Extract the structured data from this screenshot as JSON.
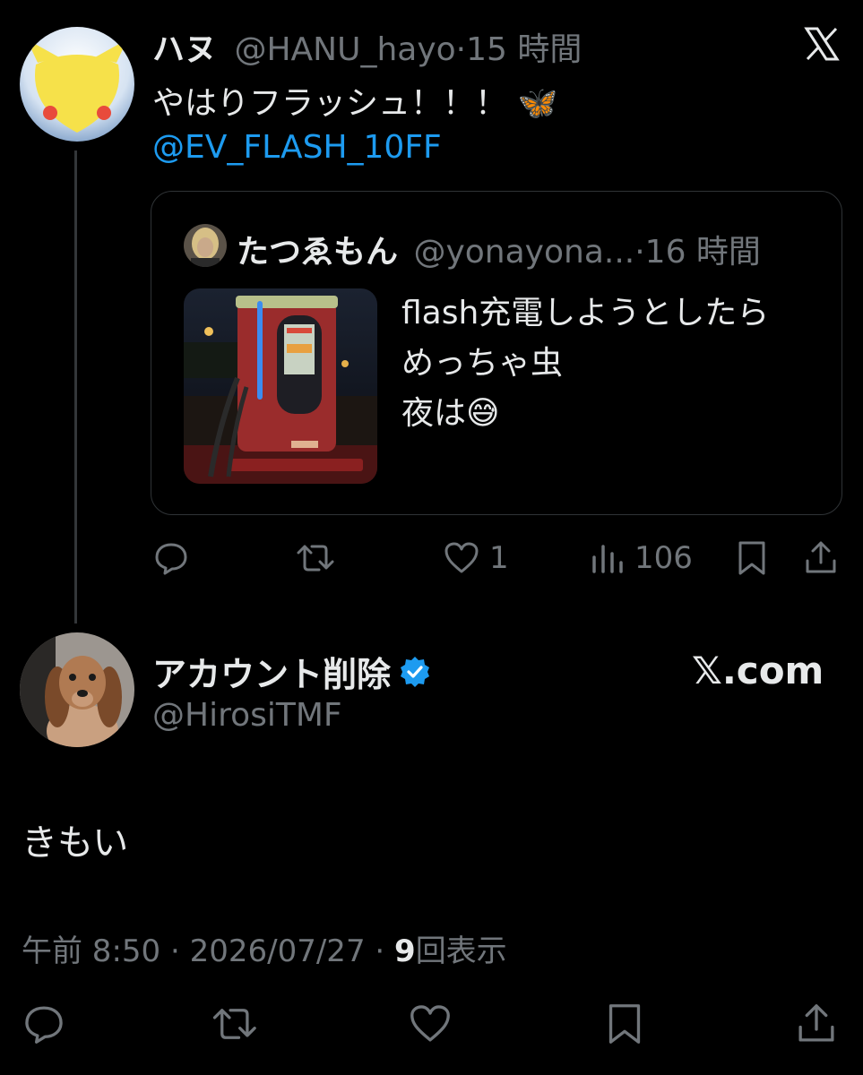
{
  "top_close_icon": "x-logo-icon",
  "reply_tweet": {
    "author_name": "ハヌ",
    "handle": "@HANU_hayo",
    "separator": "·",
    "time": "15 時間",
    "text_line1": "やはりフラッシュ！！！ 🦋",
    "mention": "@EV_FLASH_10FF",
    "quote": {
      "author_name": "たつゑもん",
      "handle": "@yonayona...",
      "separator": "·",
      "time": "16 時間",
      "text_lines": [
        "flash充電しようとしたら",
        "めっちゃ虫",
        "夜は😅"
      ]
    },
    "actions": {
      "reply_icon": "reply-icon",
      "retweet_icon": "retweet-icon",
      "like_icon": "heart-icon",
      "like_count": "1",
      "views_icon": "views-chart-icon",
      "views_count": "106",
      "bookmark_icon": "bookmark-icon",
      "share_icon": "share-icon"
    }
  },
  "main_tweet": {
    "author_name": "アカウント削除",
    "verified_icon": "verified-badge-icon",
    "handle": "@HirosiTMF",
    "brand": "𝕏.com",
    "text": "きもい",
    "meta_time": "午前 8:50",
    "meta_sep1": "·",
    "meta_date": "2026/07/27",
    "meta_sep2": "·",
    "views_count": "9",
    "views_label": "回表示"
  },
  "colors": {
    "background": "#000000",
    "text": "#e7e9ea",
    "muted": "#71767b",
    "link": "#1d9bf0",
    "border": "#2f3336"
  }
}
